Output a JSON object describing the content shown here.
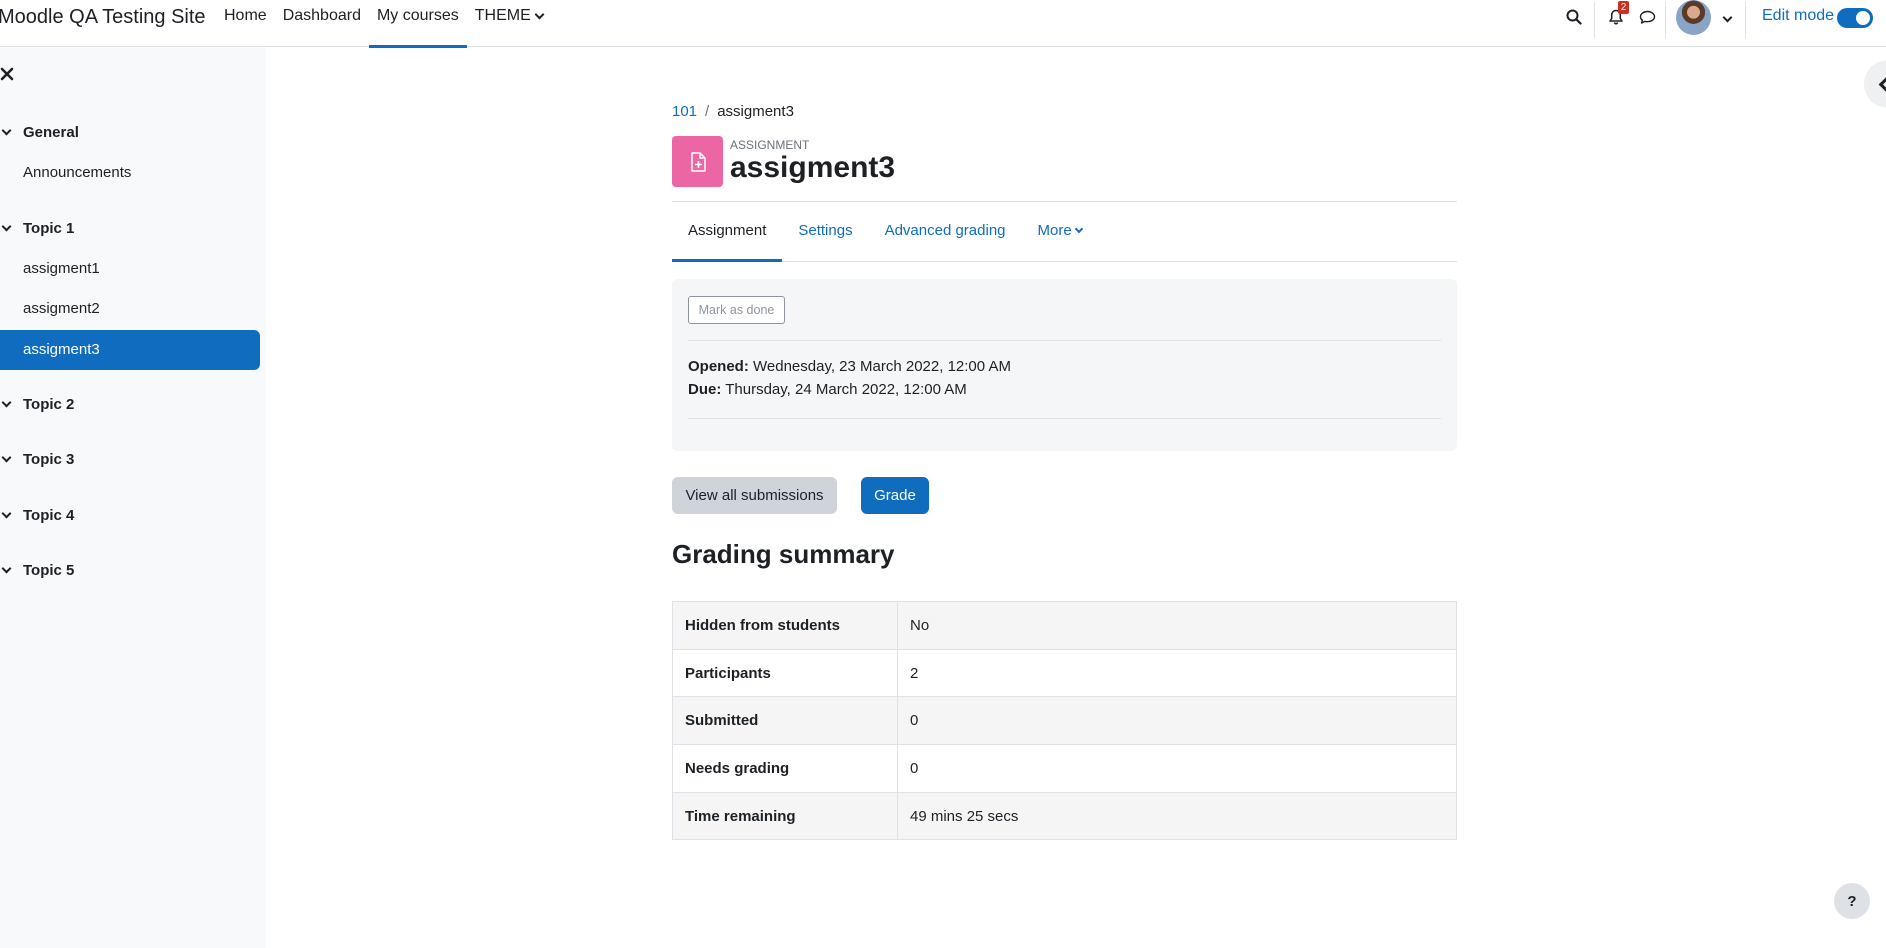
{
  "navbar": {
    "site_name": "Moodle QA Testing Site",
    "items": [
      {
        "label": "Home"
      },
      {
        "label": "Dashboard"
      },
      {
        "label": "My courses"
      },
      {
        "label": "THEME"
      }
    ],
    "notification_count": "2",
    "edit_mode_label": "Edit mode"
  },
  "drawer": {
    "sections": [
      {
        "label": "General"
      },
      {
        "label": "Topic 1"
      },
      {
        "label": "Topic 2"
      },
      {
        "label": "Topic 3"
      },
      {
        "label": "Topic 4"
      },
      {
        "label": "Topic 5"
      }
    ],
    "links": {
      "announcements": "Announcements",
      "assigment1": "assigment1",
      "assigment2": "assigment2",
      "assigment3": "assigment3"
    }
  },
  "breadcrumb": {
    "course": "101",
    "current": "assigment3"
  },
  "activity": {
    "type": "Assignment",
    "title": "assigment3"
  },
  "tabs": [
    {
      "label": "Assignment"
    },
    {
      "label": "Settings"
    },
    {
      "label": "Advanced grading"
    },
    {
      "label": "More"
    }
  ],
  "completion": {
    "button_label": "Mark as done"
  },
  "dates": {
    "opened_label": "Opened:",
    "opened_value": "Wednesday, 23 March 2022, 12:00 AM",
    "due_label": "Due:",
    "due_value": "Thursday, 24 March 2022, 12:00 AM"
  },
  "actions": {
    "view_all": "View all submissions",
    "grade": "Grade"
  },
  "grading_summary": {
    "heading": "Grading summary",
    "rows": [
      {
        "label": "Hidden from students",
        "value": "No"
      },
      {
        "label": "Participants",
        "value": "2"
      },
      {
        "label": "Submitted",
        "value": "0"
      },
      {
        "label": "Needs grading",
        "value": "0"
      },
      {
        "label": "Time remaining",
        "value": "49 mins 25 secs"
      }
    ]
  },
  "help": {
    "label": "?"
  }
}
